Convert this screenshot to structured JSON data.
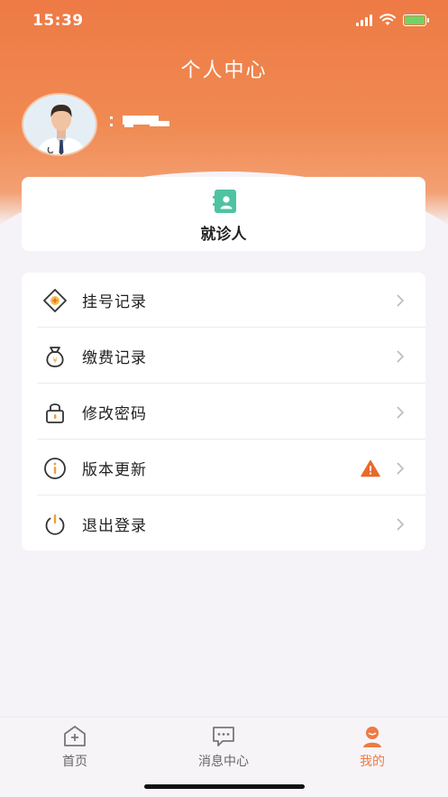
{
  "status_bar": {
    "time": "15:39"
  },
  "header": {
    "title": "个人中心"
  },
  "patient_card": {
    "label": "就诊人",
    "icon": "patient-card-icon",
    "icon_color": "#4fc3a1"
  },
  "menu": [
    {
      "label": "挂号记录",
      "icon": "registration-icon"
    },
    {
      "label": "缴费记录",
      "icon": "payment-bag-icon"
    },
    {
      "label": "修改密码",
      "icon": "lock-icon"
    },
    {
      "label": "版本更新",
      "icon": "info-icon",
      "badge": "warning-icon"
    },
    {
      "label": "退出登录",
      "icon": "power-icon"
    }
  ],
  "tabbar": {
    "items": [
      {
        "label": "首页",
        "icon": "home-icon",
        "active": false
      },
      {
        "label": "消息中心",
        "icon": "message-icon",
        "active": false
      },
      {
        "label": "我的",
        "icon": "profile-icon",
        "active": true
      }
    ]
  },
  "colors": {
    "accent": "#ee7a45",
    "warning": "#e86a2b",
    "teal": "#4fc3a1"
  }
}
